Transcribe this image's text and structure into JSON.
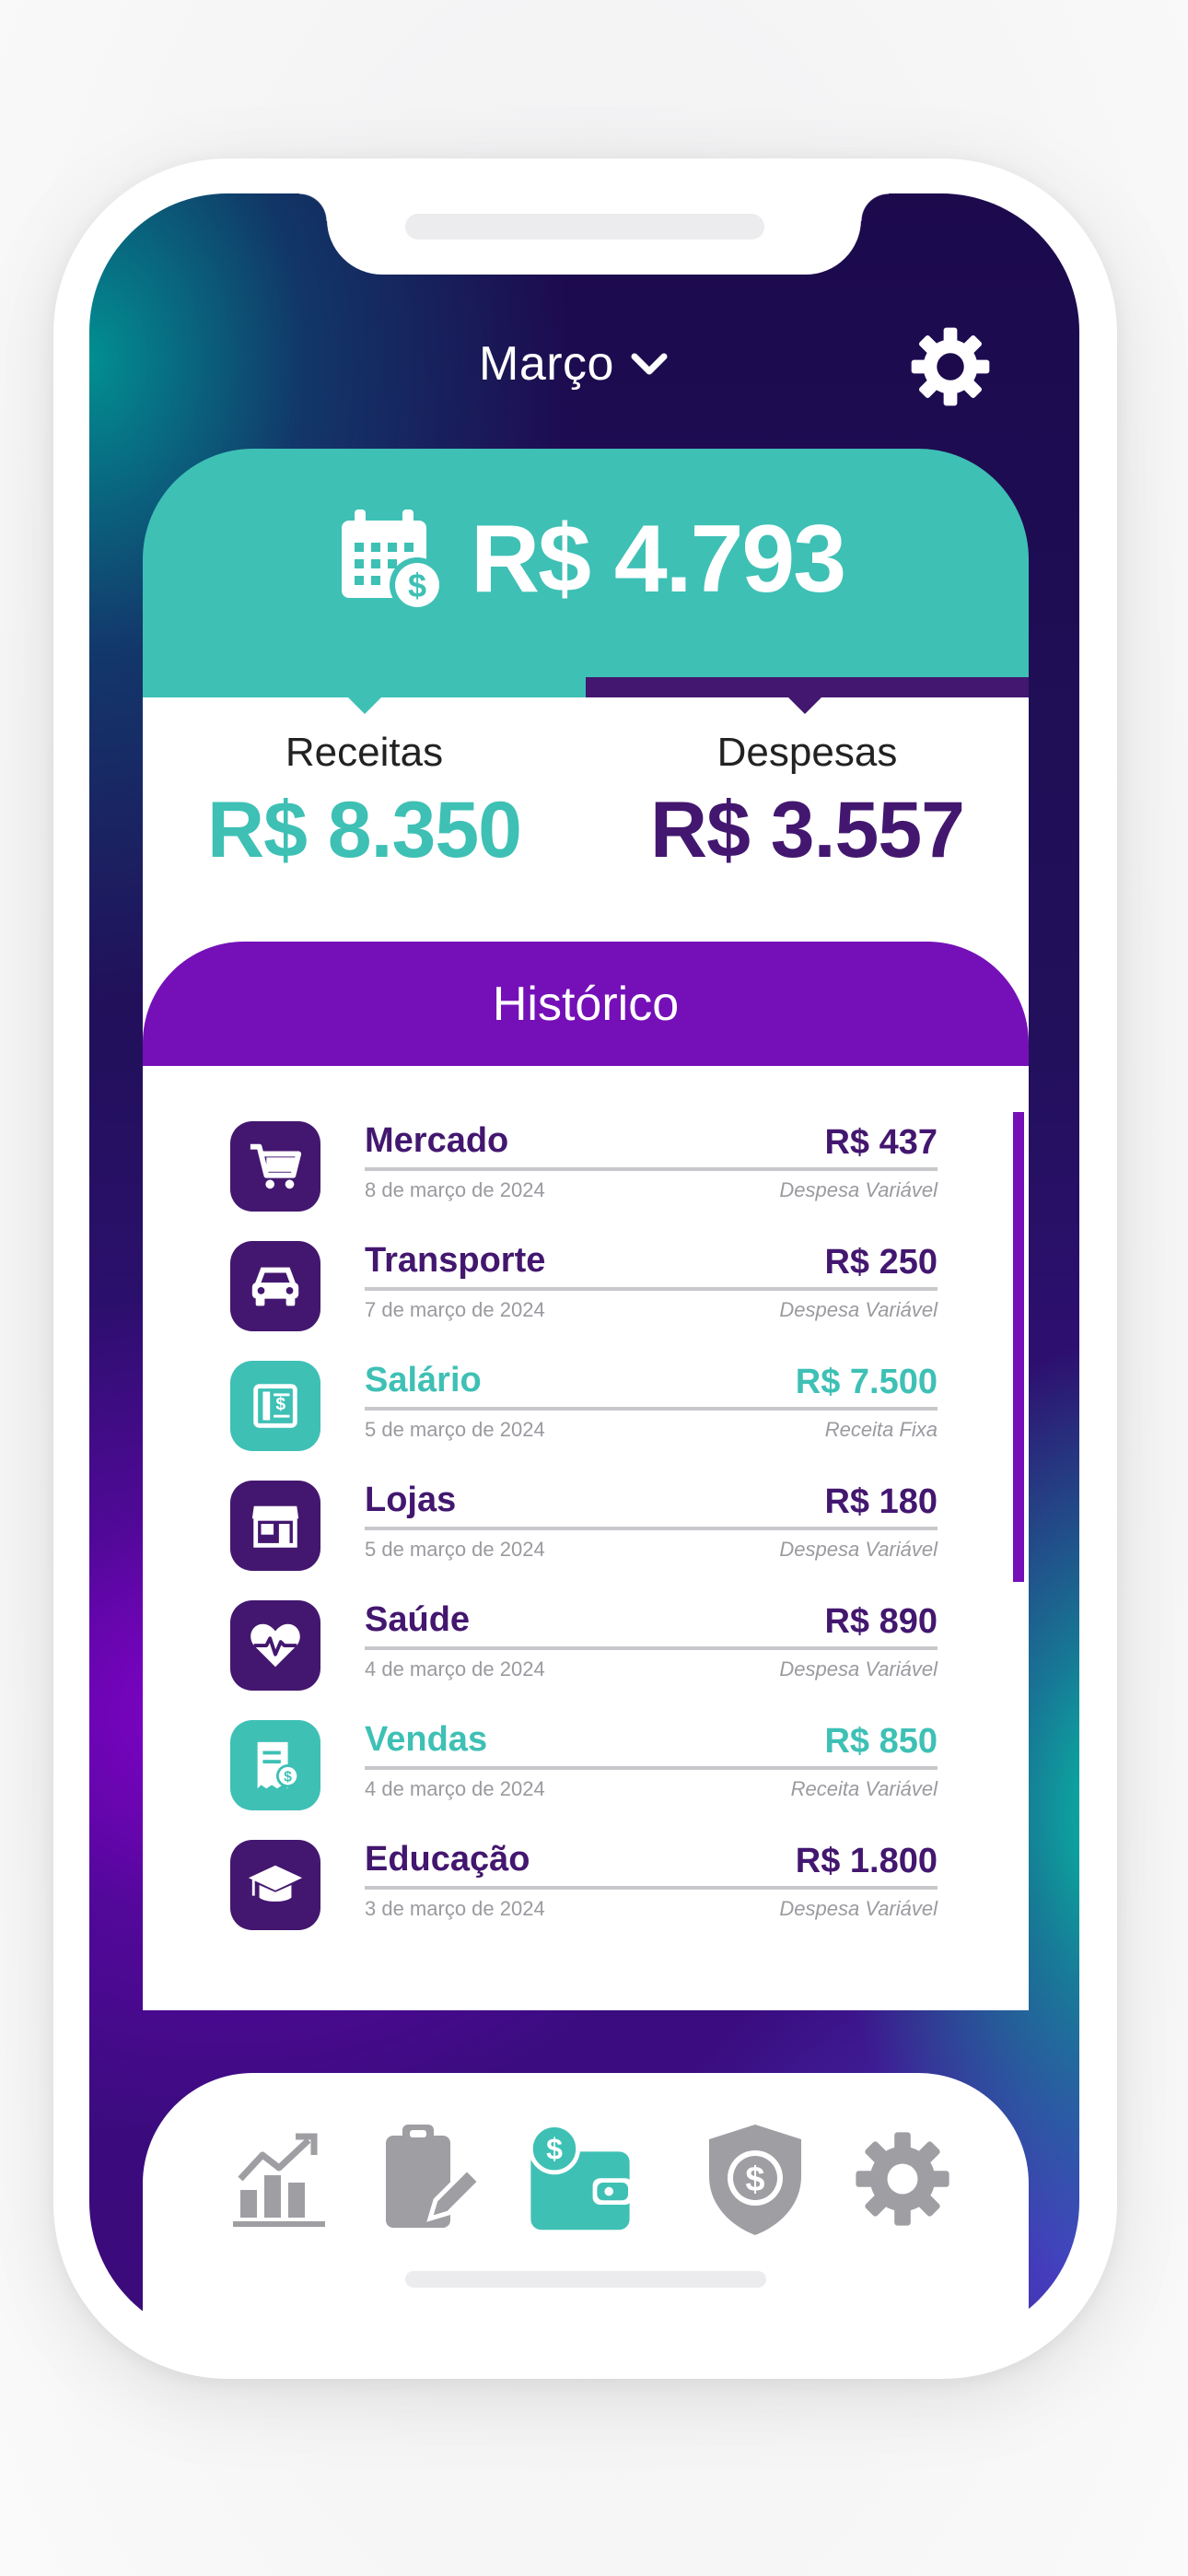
{
  "header": {
    "month_label": "Março",
    "month_icon": "chevron-down-icon",
    "settings_icon": "gear-icon"
  },
  "balance": {
    "icon": "calendar-money-icon",
    "value": "R$ 4.793"
  },
  "summary": {
    "income_label": "Receitas",
    "income_value": "R$ 8.350",
    "expense_label": "Despesas",
    "expense_value": "R$ 3.557"
  },
  "history": {
    "title": "Histórico",
    "items": [
      {
        "name": "Mercado",
        "amount": "R$ 437",
        "date": "8 de março de 2024",
        "type": "Despesa Variável",
        "icon": "shopping-cart-icon",
        "kind": "expense"
      },
      {
        "name": "Transporte",
        "amount": "R$ 250",
        "date": "7 de março de 2024",
        "type": "Despesa Variável",
        "icon": "car-icon",
        "kind": "expense"
      },
      {
        "name": "Salário",
        "amount": "R$ 7.500",
        "date": "5 de março de 2024",
        "type": "Receita Fixa",
        "icon": "paycheck-icon",
        "kind": "income"
      },
      {
        "name": "Lojas",
        "amount": "R$ 180",
        "date": "5 de março de 2024",
        "type": "Despesa Variável",
        "icon": "store-icon",
        "kind": "expense"
      },
      {
        "name": "Saúde",
        "amount": "R$ 890",
        "date": "4 de março de 2024",
        "type": "Despesa Variável",
        "icon": "heart-pulse-icon",
        "kind": "expense"
      },
      {
        "name": "Vendas",
        "amount": "R$ 850",
        "date": "4 de março de 2024",
        "type": "Receita Variável",
        "icon": "receipt-money-icon",
        "kind": "income"
      },
      {
        "name": "Educação",
        "amount": "R$ 1.800",
        "date": "3 de março de 2024",
        "type": "Despesa Variável",
        "icon": "graduation-cap-icon",
        "kind": "expense"
      }
    ]
  },
  "nav": {
    "items": [
      {
        "icon": "chart-growth-icon",
        "active": false
      },
      {
        "icon": "clipboard-edit-icon",
        "active": false
      },
      {
        "icon": "wallet-money-icon",
        "active": true
      },
      {
        "icon": "shield-money-icon",
        "active": false
      },
      {
        "icon": "gear-icon",
        "active": false
      }
    ]
  },
  "colors": {
    "teal": "#3ec0b5",
    "dark_purple": "#43176f",
    "violet": "#7510b8",
    "gray_icon": "#9e9ea3"
  }
}
